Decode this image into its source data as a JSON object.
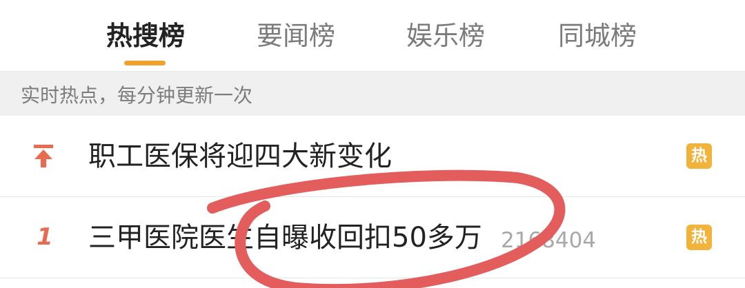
{
  "tabs": [
    {
      "label": "热搜榜",
      "active": true
    },
    {
      "label": "要闻榜",
      "active": false
    },
    {
      "label": "娱乐榜",
      "active": false
    },
    {
      "label": "同城榜",
      "active": false
    }
  ],
  "subheader": "实时热点，每分钟更新一次",
  "items": [
    {
      "rank": "",
      "title": "职工医保将迎四大新变化",
      "count": "",
      "badge": "热"
    },
    {
      "rank": "1",
      "title": "三甲医院医生自曝收回扣50多万",
      "count": "2168404",
      "badge": "热"
    }
  ],
  "colors": {
    "accent": "#f0a22f",
    "rank": "#e86b4f",
    "badge": "#f1b33b",
    "annotation_stroke": "#e35d5d"
  },
  "icons": {
    "top_pin": "pin-top-icon"
  }
}
